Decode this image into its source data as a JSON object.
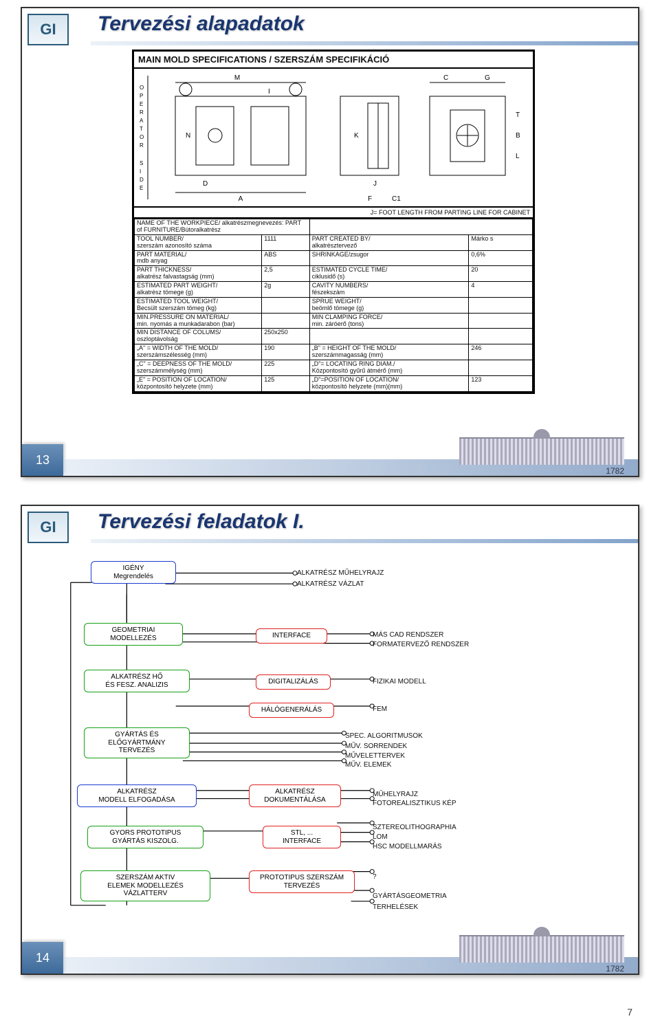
{
  "pageNumberBottom": "7",
  "building_year": "1782",
  "slide1": {
    "page_num": "13",
    "title": "Tervezési alapadatok",
    "spec": {
      "heading": "MAIN MOLD SPECIFICATIONS / SZERSZÁM SPECIFIKÁCIÓ",
      "side_label_top": "O P E R A T O R",
      "side_label_bottom": "S I D E",
      "dim_labels": {
        "M": "M",
        "I": "I",
        "C": "C",
        "G": "G",
        "N": "N",
        "D": "D",
        "K": "K",
        "J": "J",
        "T": "T",
        "B": "B",
        "L": "L",
        "A": "A",
        "F": "F",
        "C1": "C1"
      },
      "footnote": "J= FOOT LENGTH FROM PARTING LINE FOR CABINET",
      "rows": [
        [
          "NAME OF THE WORKPIECE/ alkatrészmegnevezés:",
          "PART of FURNITURE/Bútoralkatrész",
          "",
          ""
        ],
        [
          "TOOL NUMBER/\nszerszám azonosító száma",
          "1111",
          "PART CREATED BY/\nalkatrésztervező",
          "Márko s"
        ],
        [
          "PART MATERIAL/\nmdb anyag",
          "ABS",
          "SHRINKAGE/zsugor",
          "0,6%"
        ],
        [
          "PART THICKNESS/\nalkatrész falvastagság (mm)",
          "2,5",
          "ESTIMATED CYCLE TIME/\nciklusidő (s)",
          "20"
        ],
        [
          "ESTIMATED PART WEIGHT/\nalkatrész tömege (g)",
          "2g",
          "CAVITY NUMBERS/\nfészekszám",
          "4"
        ],
        [
          "ESTIMATED TOOL WEIGHT/\nBecsült szerszám tömeg (kg)",
          "",
          "SPRUE WEIGHT/\nbeömlő tömege (g)",
          ""
        ],
        [
          "MIN.PRESSURE ON MATERIAL/\nmin. nyomás a munkadarabon (bar)",
          "",
          "MIN CLAMPING FORCE/\nmin. záróerő (tons)",
          ""
        ],
        [
          "MIN DISTANCE OF COLUMS/\noszloptávolság",
          "250x250",
          "",
          ""
        ],
        [
          "„A\" = WIDTH OF THE MOLD/\nszerszámszélesség (mm)",
          "190",
          "„B\" = HEIGHT OF THE MOLD/\nszerszámmagasság (mm)",
          "246"
        ],
        [
          "„C\" = DEEPNESS OF THE MOLD/\nszerszámmélység (mm)",
          "225",
          "„D\"= LOCATING RING DIAM./\nKözpontosító gyűrű átmérő (mm)",
          ""
        ],
        [
          "„E\" = POSITION OF LOCATION/\nközpontosító helyzete (mm)",
          "125",
          "„D\"=POSITION OF LOCATION/\nközpontosító helyzete (mm)(mm)",
          "123"
        ]
      ]
    }
  },
  "slide2": {
    "page_num": "14",
    "title": "Tervezési feladatok I.",
    "boxes": {
      "igeny": "IGÉNY\nMegrendelés",
      "geo": "GEOMETRIAI\nMODELLEZÉS",
      "ho": "ALKATRÉSZ HŐ\nÉS FESZ. ANALIZIS",
      "gyartas": "GYÁRTÁS ÉS\nELŐGYÁRTMÁNY\nTERVEZÉS",
      "modell_elf": "ALKATRÉSZ\nMODELL ELFOGADÁSA",
      "gyors": "GYORS PROTOTIPUS\nGYÁRTÁS KISZOLG.",
      "szerszam": "SZERSZÁM AKTIV\nELEMEK MODELLEZÉS\nVÁZLATTERV",
      "interface": "INTERFACE",
      "digit": "DIGITALIZÁLÁS",
      "halo": "HÁLÓGENERÁLÁS",
      "dokum": "ALKATRÉSZ\nDOKUMENTÁLÁSA",
      "stl": "STL, ...\nINTERFACE",
      "proto": "PROTOTIPUS SZERSZÁM\nTERVEZÉS"
    },
    "labels": {
      "muhelyrajz": "ALKATRÉSZ MŰHELYRAJZ",
      "vazlat": "ALKATRÉSZ VÁZLAT",
      "mascad": "MÁS CAD RENDSZER",
      "format": "FORMATERVEZŐ RENDSZER",
      "fizikai": "FIZIKAI MODELL",
      "fem": "FEM",
      "spec_alg": "SPEC. ALGORITMUSOK",
      "muv_sor": "MŰV. SORRENDEK",
      "muv_terv": "MŰVELETTERVEK",
      "muv_elem": "MŰV. ELEMEK",
      "muhelyrajz2": "MŰHELYRAJZ",
      "fotoreal": "FOTOREALISZTIKUS KÉP",
      "sztereo": "SZTEREOLITHOGRAPHIA",
      "lom": "LOM",
      "hsc": "HSC MODELLMARÁS",
      "q": "?",
      "gyartgeo": "GYÁRTÁSGEOMETRIA",
      "terhel": "TERHELÉSEK"
    }
  }
}
